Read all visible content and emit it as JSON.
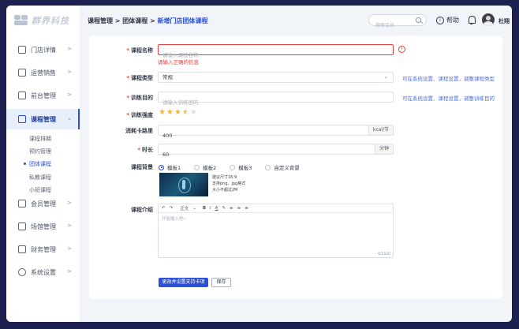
{
  "logo": {
    "text": "群界科技"
  },
  "sidebar": {
    "items": [
      {
        "label": "门店详情",
        "icon": "store-icon"
      },
      {
        "label": "运营销售",
        "icon": "sales-icon"
      },
      {
        "label": "前台管理",
        "icon": "reception-icon"
      },
      {
        "label": "课程管理",
        "icon": "book-icon"
      },
      {
        "label": "会员管理",
        "icon": "member-icon"
      },
      {
        "label": "场馆管理",
        "icon": "venue-icon"
      },
      {
        "label": "财务管理",
        "icon": "finance-icon"
      },
      {
        "label": "系统设置",
        "icon": "settings-icon"
      }
    ],
    "subitems": [
      {
        "label": "课程排期"
      },
      {
        "label": "预约管理"
      },
      {
        "label": "团体课程"
      },
      {
        "label": "私教课程"
      },
      {
        "label": "小班课程"
      }
    ]
  },
  "header": {
    "breadcrumb": {
      "b1": "课程管理",
      "sep": " > ",
      "b2": "团体课程",
      "b3": "新增门店团体课程"
    },
    "search_placeholder": "搜索会员",
    "help_label": "帮助",
    "username": "杜翔"
  },
  "form": {
    "course_name": {
      "label": "课程名称",
      "placeholder": "请输入课程名称",
      "error": "请输入正确的信息"
    },
    "course_type": {
      "label": "课程类型",
      "value": "常规",
      "hint": "可在系统设置、课程设置，调整课程类型"
    },
    "goal": {
      "label": "训练目的",
      "placeholder": "请输入训练目的",
      "hint": "可在系统设置、课程设置，调整训练目的"
    },
    "intensity": {
      "label": "训练强度",
      "rating": 3.5,
      "max": 5,
      "star_color": "#f4b63a",
      "empty_color": "#dcdfe6"
    },
    "calories": {
      "label": "消耗卡路里",
      "value": "400",
      "unit": "kcal/节"
    },
    "duration": {
      "label": "时长",
      "value": "60",
      "unit": "分钟"
    },
    "background": {
      "label": "课程背景",
      "options": [
        {
          "label": "模板1",
          "checked": true
        },
        {
          "label": "模板2",
          "checked": false
        },
        {
          "label": "模板3",
          "checked": false
        },
        {
          "label": "自定义背景",
          "checked": false
        }
      ],
      "notes": [
        "建议尺寸16:9",
        "支持png、jpg格式",
        "大小不超过2M"
      ]
    },
    "intro": {
      "label": "课程介绍",
      "toolbar": [
        "↶",
        "↷",
        "正文",
        "⌄",
        "B",
        "I",
        "A",
        "✎",
        "≡",
        "≡",
        "≡"
      ],
      "placeholder": "开始输入吧~",
      "counter": "0/1500"
    },
    "buttons": {
      "submit": "更改并设置支持卡项",
      "save": "保存"
    }
  },
  "colors": {
    "accent": "#2b50d4",
    "error": "#e5413a",
    "hint": "#4c6fd8"
  }
}
